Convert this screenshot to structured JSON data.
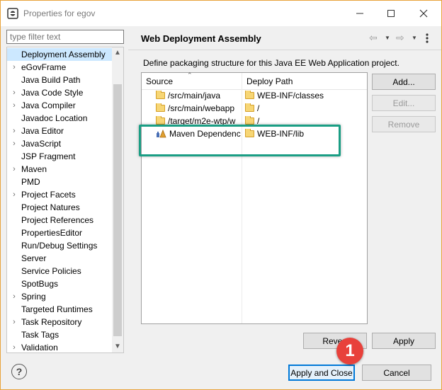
{
  "window": {
    "title": "Properties for egov"
  },
  "filter": {
    "placeholder": "type filter text"
  },
  "tree": {
    "items": [
      {
        "label": "Deployment Assembly",
        "expandable": false,
        "selected": true
      },
      {
        "label": "eGovFrame",
        "expandable": true
      },
      {
        "label": "Java Build Path",
        "expandable": false
      },
      {
        "label": "Java Code Style",
        "expandable": true
      },
      {
        "label": "Java Compiler",
        "expandable": true
      },
      {
        "label": "Javadoc Location",
        "expandable": false
      },
      {
        "label": "Java Editor",
        "expandable": true
      },
      {
        "label": "JavaScript",
        "expandable": true
      },
      {
        "label": "JSP Fragment",
        "expandable": false
      },
      {
        "label": "Maven",
        "expandable": true
      },
      {
        "label": "PMD",
        "expandable": false
      },
      {
        "label": "Project Facets",
        "expandable": true
      },
      {
        "label": "Project Natures",
        "expandable": false
      },
      {
        "label": "Project References",
        "expandable": false
      },
      {
        "label": "PropertiesEditor",
        "expandable": false
      },
      {
        "label": "Run/Debug Settings",
        "expandable": false
      },
      {
        "label": "Server",
        "expandable": false
      },
      {
        "label": "Service Policies",
        "expandable": false
      },
      {
        "label": "SpotBugs",
        "expandable": false
      },
      {
        "label": "Spring",
        "expandable": true
      },
      {
        "label": "Targeted Runtimes",
        "expandable": false
      },
      {
        "label": "Task Repository",
        "expandable": true
      },
      {
        "label": "Task Tags",
        "expandable": false
      },
      {
        "label": "Validation",
        "expandable": true
      }
    ]
  },
  "page": {
    "title": "Web Deployment Assembly",
    "description": "Define packaging structure for this Java EE Web Application project."
  },
  "table": {
    "columns": [
      "Source",
      "Deploy Path"
    ],
    "rows": [
      {
        "source": "/src/main/java",
        "deploy": "WEB-INF/classes",
        "icon": "folder-icon"
      },
      {
        "source": "/src/main/webapp",
        "deploy": "/",
        "icon": "folder-icon"
      },
      {
        "source": "/target/m2e-wtp/w",
        "deploy": "/",
        "icon": "folder-icon"
      },
      {
        "source": "Maven Dependenc",
        "deploy": "WEB-INF/lib",
        "icon": "library-icon"
      }
    ]
  },
  "buttons": {
    "add": "Add...",
    "edit": "Edit...",
    "remove": "Remove",
    "revert": "Revert",
    "apply": "Apply",
    "apply_close": "Apply and Close",
    "cancel": "Cancel"
  },
  "annotation": {
    "step": "1"
  },
  "colors": {
    "highlight": "#1a9e84",
    "badge": "#e8413b",
    "selection": "#cce8ff",
    "focus": "#0078d7"
  }
}
